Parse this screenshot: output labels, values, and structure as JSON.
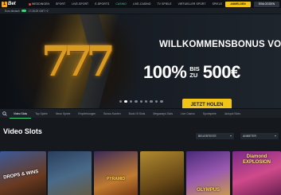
{
  "brand": {
    "one": "1",
    "word": "Bet"
  },
  "topnav": {
    "items": [
      {
        "label": "WEDDINGEN",
        "live": true
      },
      {
        "label": "SPORT"
      },
      {
        "label": "LIVE-SPORT"
      },
      {
        "label": "E-SPORTS"
      },
      {
        "label": "CASINO",
        "active": true
      },
      {
        "label": "LIVE-CASINO"
      },
      {
        "label": "TV SPIELE"
      },
      {
        "label": "VIRTUELLER SPORT"
      },
      {
        "label": "SPIELE"
      },
      {
        "label": "PROMOTIONS"
      }
    ],
    "register_label": "ANMELDEN",
    "login_label": "EINLOGGEN"
  },
  "subbar": {
    "toggle_label": "Euro deutsch",
    "time": "17:28:29 GMT +2"
  },
  "hero": {
    "sevens": "777",
    "title": "WILLKOMMENSBONUS VON",
    "percent": "100%",
    "mid_top": "BIS",
    "mid_bottom": "ZU",
    "amount": "500€",
    "cta": "JETZT HOLEN",
    "slides": 9,
    "active_slide": 1
  },
  "tabs": [
    {
      "label": "Video Slots",
      "active": true
    },
    {
      "label": "Top Spiele"
    },
    {
      "label": "Neue Spiele"
    },
    {
      "label": "Empfehlungen"
    },
    {
      "label": "Bonus Kaufen"
    },
    {
      "label": "Book Of Slots"
    },
    {
      "label": "Megaways Slots"
    },
    {
      "label": "Live Casino"
    },
    {
      "label": "Sportspiele"
    },
    {
      "label": "Jackpot Slots"
    }
  ],
  "section": {
    "title": "Video Slots",
    "sort_label": "BELIEBTESTE",
    "provider_label": "ANBIETER"
  },
  "games": [
    {
      "label": "DROPS & WINS"
    },
    {
      "label": ""
    },
    {
      "label": "PYRAMID"
    },
    {
      "label": ""
    },
    {
      "label": "OLYMPUS"
    },
    {
      "label": "Diamond EXPLOSION"
    }
  ]
}
